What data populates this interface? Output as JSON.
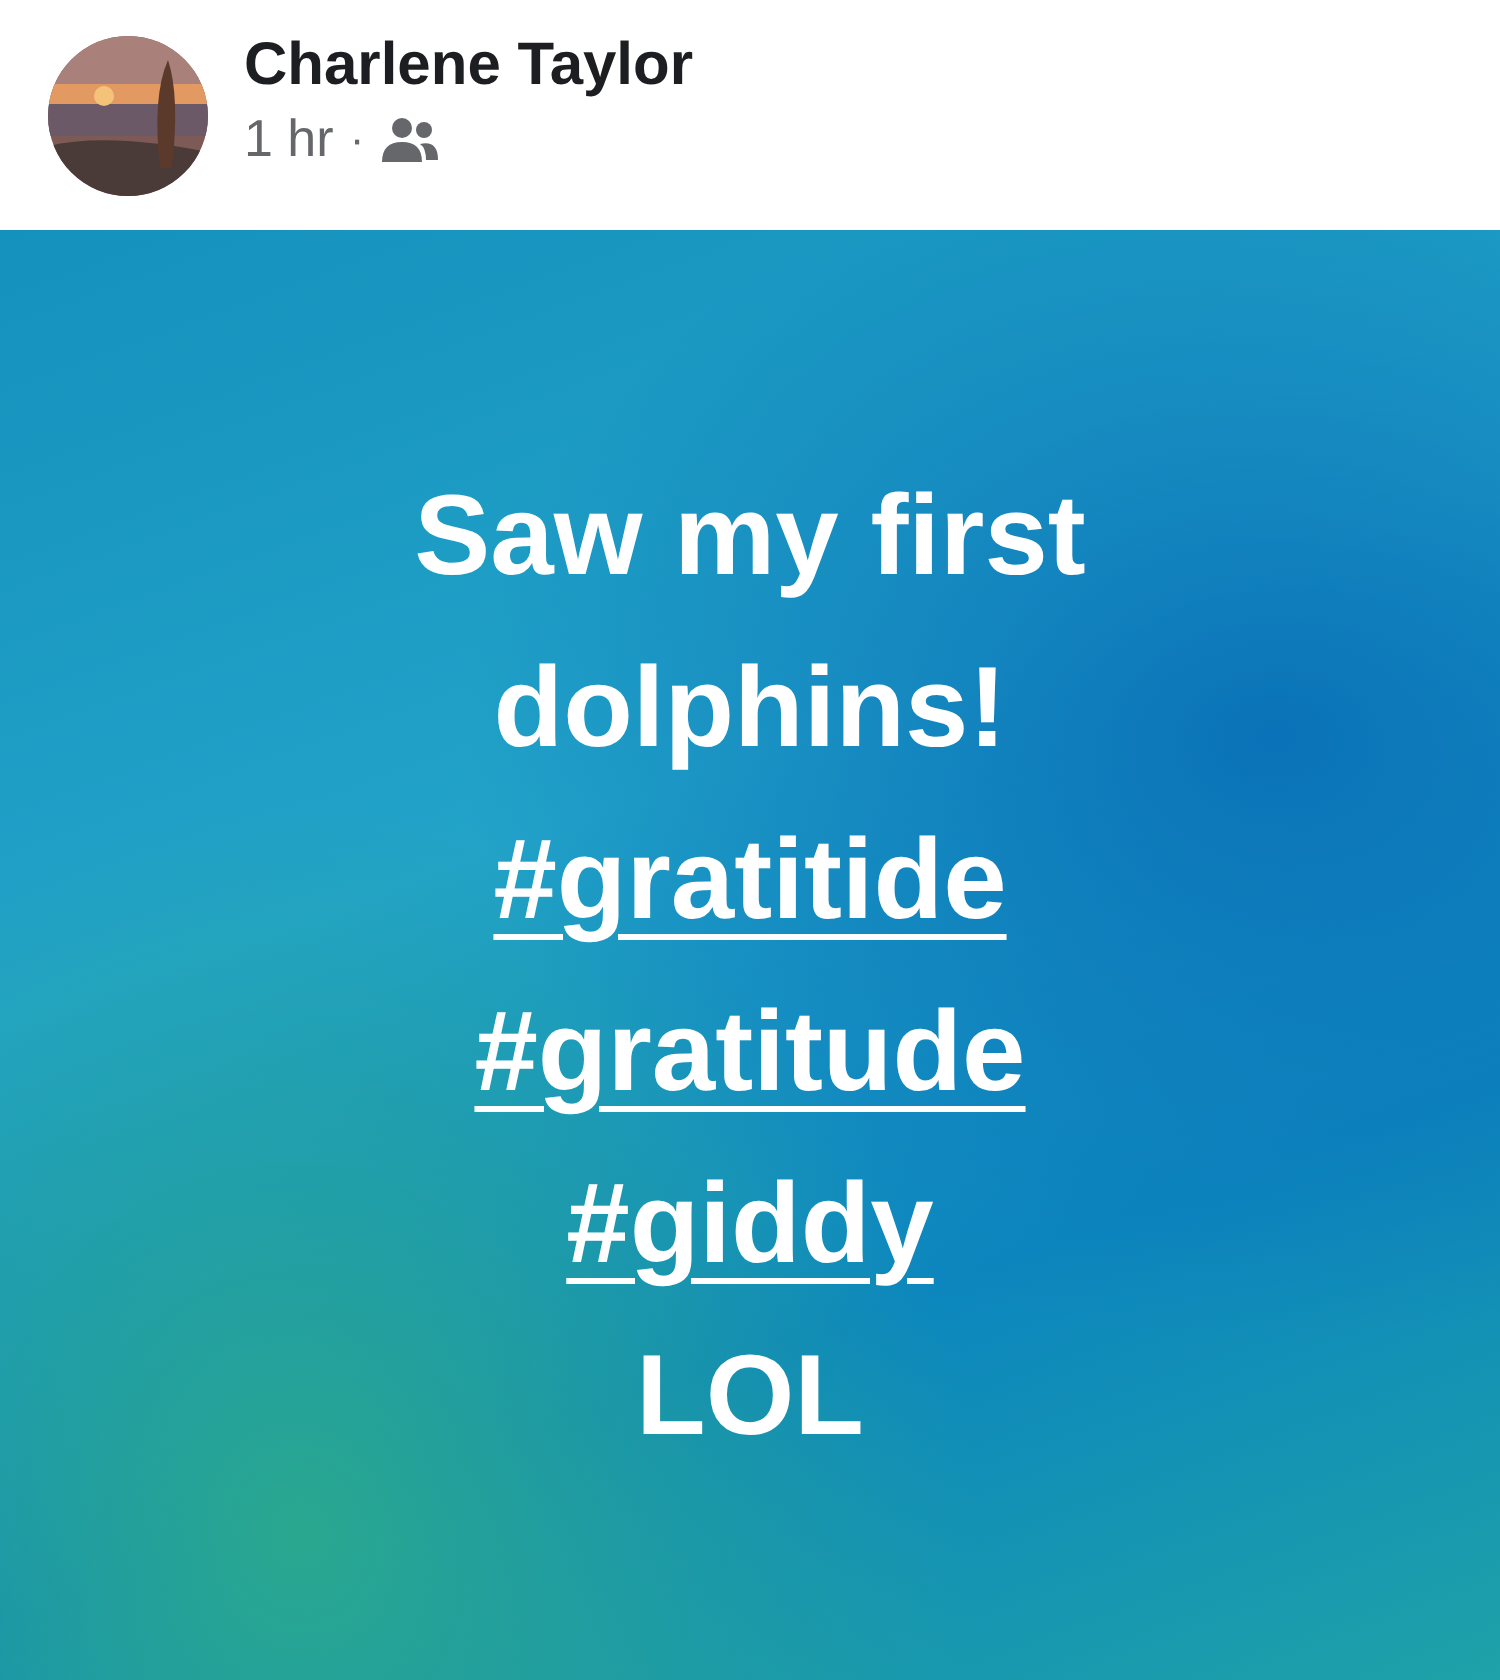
{
  "post": {
    "author": "Charlene Taylor",
    "time": "1 hr",
    "separator": "·",
    "segments": [
      {
        "kind": "text",
        "text": "Saw my first dolphins!"
      },
      {
        "kind": "hashtag",
        "text": "#gratitide"
      },
      {
        "kind": "hashtag",
        "text": "#gratitude"
      },
      {
        "kind": "hashtag",
        "text": "#giddy"
      },
      {
        "kind": "text",
        "text": "LOL"
      }
    ]
  }
}
